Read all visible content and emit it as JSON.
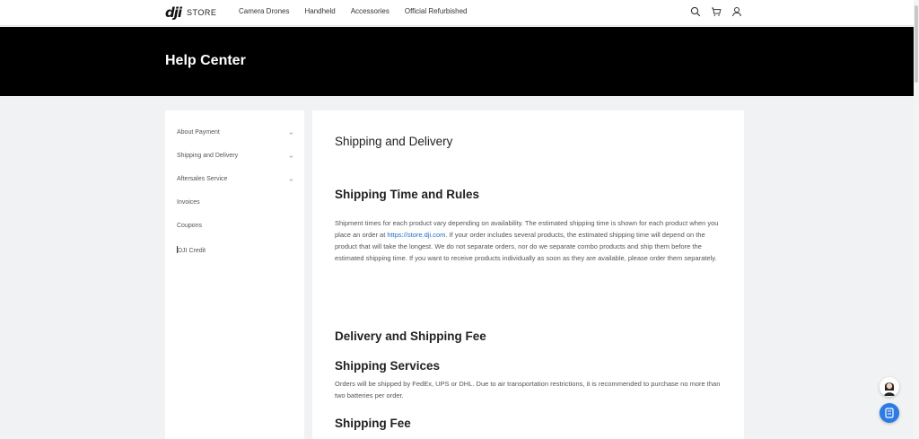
{
  "brand": {
    "logo": "dji",
    "store_label": "STORE"
  },
  "nav": {
    "links": [
      "Camera Drones",
      "Handheld",
      "Accessories",
      "Official Refurbished"
    ],
    "icons": [
      "search-icon",
      "cart-icon",
      "user-icon"
    ]
  },
  "hero": {
    "title": "Help Center"
  },
  "sidebar": {
    "items": [
      {
        "label": "About Payment",
        "expandable": true
      },
      {
        "label": "Shipping and Delivery",
        "expandable": true
      },
      {
        "label": "Aftersales Service",
        "expandable": true
      },
      {
        "label": "Invoices",
        "expandable": false
      },
      {
        "label": "Coupons",
        "expandable": false
      },
      {
        "label": "DJI Credit",
        "expandable": false
      }
    ]
  },
  "content": {
    "page_title": "Shipping and Delivery",
    "section1_title": "Shipping Time and Rules",
    "section1_text_before": "Shipment times for each product vary depending on availability. The estimated shipping time is shown for each product when you place an order at ",
    "section1_link": "https://store.dji.com",
    "section1_text_after": ". If your order includes several products, the estimated shipping time will depend on the product that will take the longest. We do not separate orders, nor do we separate combo products and ship them before the estimated shipping time. If you want to receive products individually as soon as they are available, please order them separately.",
    "section2_title": "Delivery and Shipping Fee",
    "section3_title": "Shipping Services",
    "section3_text": "Orders will be shipped by FedEx, UPS or DHL. Due to air transportation restrictions, it is recommended to purchase no more than two batteries per order.",
    "section4_title": "Shipping Fee"
  },
  "colors": {
    "link": "#1e6fc7",
    "hero_bg": "#000000",
    "page_bg": "#f1f2f3",
    "chat_button": "#2c7be5"
  }
}
